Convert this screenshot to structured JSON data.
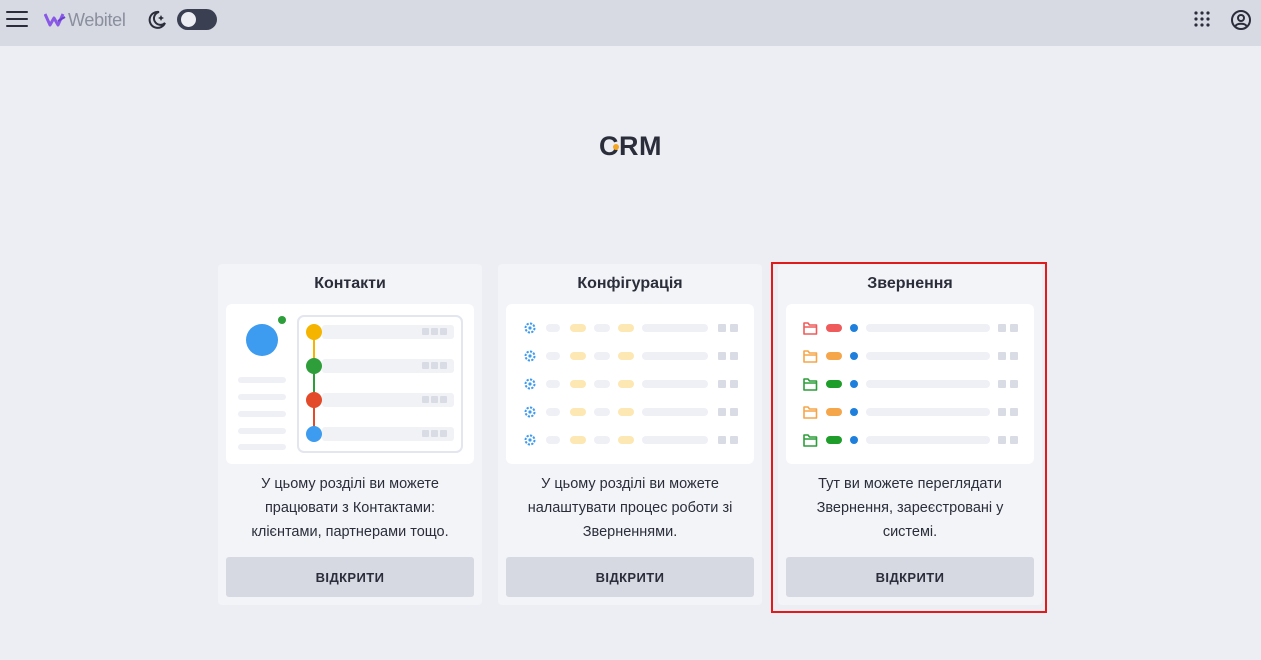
{
  "header": {
    "brand": "Webitel",
    "icons": {
      "menu": "hamburger-icon",
      "theme": "moon-icon",
      "apps": "grid-icon",
      "account": "account-icon"
    },
    "theme_toggle_on": true
  },
  "main": {
    "title_c": "C",
    "title_rest": "RM"
  },
  "cards": [
    {
      "title": "Контакти",
      "description": "У цьому розділі ви можете працювати з Контактами: клієнтами, партнерами тощо.",
      "button_label": "ВІДКРИТИ"
    },
    {
      "title": "Конфігурація",
      "description": "У цьому розділі ви можете налаштувати процес роботи зі Зверненнями.",
      "button_label": "ВІДКРИТИ"
    },
    {
      "title": "Звернення",
      "description": "Тут ви можете переглядати Звернення, зареєстровані у системі.",
      "button_label": "ВІДКРИТИ"
    }
  ],
  "colors": {
    "accent_red": "#e01b1b",
    "yellow": "#f5b400",
    "green": "#2e9e3a",
    "red": "#e34a2a",
    "blue": "#3d9bf0",
    "orange": "#f5a54a"
  }
}
